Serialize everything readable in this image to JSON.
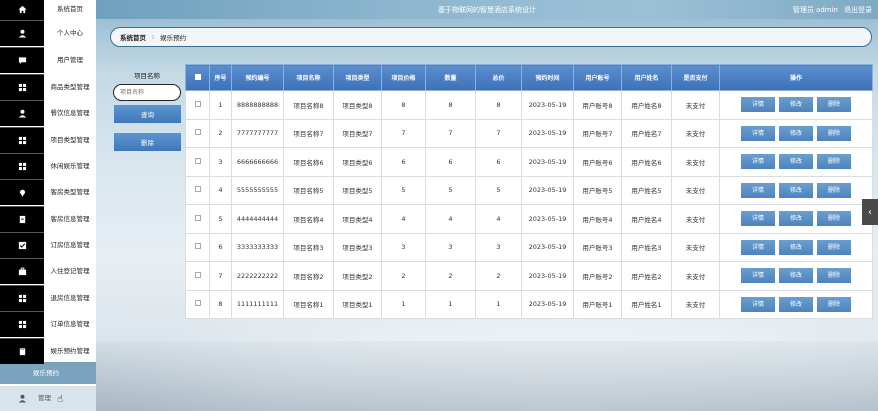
{
  "header": {
    "title": "基于物联网的智慧酒店系统设计",
    "admin_label": "管理员 admin",
    "logout_label": "退出登录"
  },
  "sidebar": {
    "items": [
      {
        "label": "系统首页",
        "icon": "home-icon"
      },
      {
        "label": "个人中心",
        "icon": "user-icon"
      },
      {
        "label": "用户管理",
        "icon": "chat-icon"
      },
      {
        "label": "商品类型管理",
        "icon": "grid-icon"
      },
      {
        "label": "餐饮信息管理",
        "icon": "user-icon"
      },
      {
        "label": "项目类型管理",
        "icon": "grid-icon"
      },
      {
        "label": "休闲娱乐管理",
        "icon": "grid-icon"
      },
      {
        "label": "客房类型管理",
        "icon": "location-icon"
      },
      {
        "label": "客房信息管理",
        "icon": "doc-icon"
      },
      {
        "label": "订房信息管理",
        "icon": "check-icon"
      },
      {
        "label": "入住登记管理",
        "icon": "briefcase-icon"
      },
      {
        "label": "退房信息管理",
        "icon": "grid-icon"
      },
      {
        "label": "订单信息管理",
        "icon": "grid-icon"
      },
      {
        "label": "娱乐预约管理",
        "icon": "clipboard-icon"
      }
    ],
    "active_sub": "娱乐预约",
    "bottom_label": "管理"
  },
  "breadcrumb": {
    "home": "系统首页",
    "separator": "⁝",
    "current": "娱乐预约"
  },
  "search": {
    "label": "项目名称",
    "placeholder": "项目名称",
    "query_button": "查询",
    "delete_button": "删除"
  },
  "table": {
    "headers": [
      "序号",
      "预约编号",
      "项目名称",
      "项目类型",
      "项目价格",
      "数量",
      "总价",
      "预约时间",
      "用户账号",
      "用户姓名",
      "是否支付",
      "操作"
    ],
    "actions": [
      "详情",
      "修改",
      "删除"
    ],
    "rows": [
      {
        "no": "1",
        "code": "8888888888",
        "name": "项目名称8",
        "type": "项目类型8",
        "price": "8",
        "qty": "8",
        "total": "8",
        "date": "2023-05-19",
        "account": "用户账号8",
        "username": "用户姓名8",
        "paid": "未支付"
      },
      {
        "no": "2",
        "code": "7777777777",
        "name": "项目名称7",
        "type": "项目类型7",
        "price": "7",
        "qty": "7",
        "total": "7",
        "date": "2023-05-19",
        "account": "用户账号7",
        "username": "用户姓名7",
        "paid": "未支付"
      },
      {
        "no": "3",
        "code": "6666666666",
        "name": "项目名称6",
        "type": "项目类型6",
        "price": "6",
        "qty": "6",
        "total": "6",
        "date": "2023-05-19",
        "account": "用户账号6",
        "username": "用户姓名6",
        "paid": "未支付"
      },
      {
        "no": "4",
        "code": "5555555555",
        "name": "项目名称5",
        "type": "项目类型5",
        "price": "5",
        "qty": "5",
        "total": "5",
        "date": "2023-05-19",
        "account": "用户账号5",
        "username": "用户姓名5",
        "paid": "未支付"
      },
      {
        "no": "5",
        "code": "4444444444",
        "name": "项目名称4",
        "type": "项目类型4",
        "price": "4",
        "qty": "4",
        "total": "4",
        "date": "2023-05-19",
        "account": "用户账号4",
        "username": "用户姓名4",
        "paid": "未支付"
      },
      {
        "no": "6",
        "code": "3333333333",
        "name": "项目名称3",
        "type": "项目类型3",
        "price": "3",
        "qty": "3",
        "total": "3",
        "date": "2023-05-19",
        "account": "用户账号3",
        "username": "用户姓名3",
        "paid": "未支付"
      },
      {
        "no": "7",
        "code": "2222222222",
        "name": "项目名称2",
        "type": "项目类型2",
        "price": "2",
        "qty": "2",
        "total": "2",
        "date": "2023-05-19",
        "account": "用户账号2",
        "username": "用户姓名2",
        "paid": "未支付"
      },
      {
        "no": "8",
        "code": "1111111111",
        "name": "项目名称1",
        "type": "项目类型1",
        "price": "1",
        "qty": "1",
        "total": "1",
        "date": "2023-05-19",
        "account": "用户账号1",
        "username": "用户姓名1",
        "paid": "未支付"
      }
    ]
  },
  "colors": {
    "accent": "#3d70b5",
    "topbar": "#8db7cf",
    "sidebar_icon_bg": "#000000",
    "active": "#7aa4be"
  }
}
